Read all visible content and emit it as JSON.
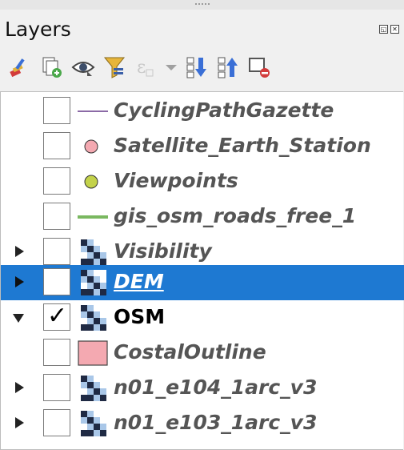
{
  "panel": {
    "title": "Layers"
  },
  "window_buttons": [
    "float-icon",
    "close-icon"
  ],
  "toolbar": [
    {
      "name": "style-manager-button",
      "icon": "paintbrush-icon"
    },
    {
      "name": "add-group-button",
      "icon": "add-group-icon"
    },
    {
      "name": "manage-visibility-button",
      "icon": "eye-icon"
    },
    {
      "name": "filter-legend-button",
      "icon": "filter-icon"
    },
    {
      "name": "filter-by-expression-button",
      "icon": "expression-icon"
    },
    {
      "name": "expression-dropdown-button",
      "icon": "chevron-down-icon"
    },
    {
      "name": "expand-all-button",
      "icon": "expand-all-icon"
    },
    {
      "name": "collapse-all-button",
      "icon": "collapse-all-icon"
    },
    {
      "name": "remove-layer-button",
      "icon": "remove-layer-icon"
    }
  ],
  "layers": [
    {
      "name": "CyclingPathGazette",
      "symbol": "line",
      "color": "#8b6aa6",
      "checked": false,
      "expander": "none"
    },
    {
      "name": "Satellite_Earth_Station",
      "symbol": "point",
      "color": "#f4a9b1",
      "checked": false,
      "expander": "none"
    },
    {
      "name": "Viewpoints",
      "symbol": "point",
      "color": "#c3d24a",
      "checked": false,
      "expander": "none"
    },
    {
      "name": "gis_osm_roads_free_1",
      "symbol": "line-thick",
      "color": "#7ab860",
      "checked": false,
      "expander": "none"
    },
    {
      "name": "Visibility",
      "symbol": "raster",
      "checked": false,
      "expander": "collapsed"
    },
    {
      "name": "DEM",
      "symbol": "raster",
      "checked": false,
      "expander": "collapsed",
      "selected": true
    },
    {
      "name": "OSM",
      "symbol": "raster",
      "checked": true,
      "expander": "expanded",
      "active": true
    },
    {
      "name": "CostalOutline",
      "symbol": "polygon",
      "color": "#f4a9b1",
      "checked": false,
      "expander": "none"
    },
    {
      "name": "n01_e104_1arc_v3",
      "symbol": "raster",
      "checked": false,
      "expander": "collapsed"
    },
    {
      "name": "n01_e103_1arc_v3",
      "symbol": "raster",
      "checked": false,
      "expander": "collapsed"
    }
  ],
  "selection_color": "#1e79d2"
}
